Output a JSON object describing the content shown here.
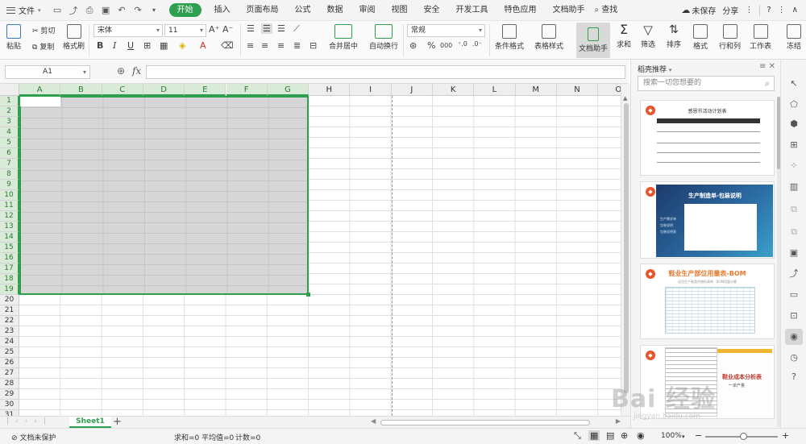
{
  "menubar": {
    "file": "文件",
    "tabs": [
      {
        "label": "开始",
        "active": true
      },
      {
        "label": "插入"
      },
      {
        "label": "页面布局"
      },
      {
        "label": "公式"
      },
      {
        "label": "数据"
      },
      {
        "label": "审阅"
      },
      {
        "label": "视图"
      },
      {
        "label": "安全"
      },
      {
        "label": "开发工具"
      },
      {
        "label": "特色应用"
      },
      {
        "label": "文档助手"
      }
    ],
    "search": "查找",
    "unsaved": "未保存",
    "share": "分享",
    "accent": "#2e9e4f"
  },
  "ribbon": {
    "paste": "粘贴",
    "cut": "剪切",
    "copy": "复制",
    "format_painter": "格式刷",
    "font_name": "宋体",
    "font_size": "11",
    "bold": "B",
    "italic": "I",
    "underline": "U",
    "font_grow": "A⁺",
    "font_shrink": "A⁻",
    "merge_center": "合并居中",
    "wrap_text": "自动换行",
    "number_format": "常规",
    "percent": "%",
    "thousands": "000",
    "cond_format": "条件格式",
    "table_style": "表格样式",
    "doc_helper": "文档助手",
    "sum": "求和",
    "filter": "筛选",
    "sort": "排序",
    "format": "格式",
    "rows_cols": "行和列",
    "worksheet": "工作表",
    "freeze": "冻结"
  },
  "formula_bar": {
    "name_box": "A1",
    "fx": "fx",
    "value": ""
  },
  "grid": {
    "columns": [
      "A",
      "B",
      "C",
      "D",
      "E",
      "F",
      "G",
      "H",
      "I",
      "J",
      "K",
      "L",
      "M",
      "N",
      "O"
    ],
    "rows": [
      "1",
      "2",
      "3",
      "4",
      "5",
      "6",
      "7",
      "8",
      "9",
      "10",
      "11",
      "12",
      "13",
      "14",
      "15",
      "16",
      "17",
      "18",
      "19",
      "20",
      "21",
      "22",
      "23",
      "24",
      "25",
      "26",
      "27",
      "28",
      "29",
      "30",
      "31"
    ],
    "selection": "A1:G19"
  },
  "sheets": {
    "tabs": [
      "Sheet1"
    ],
    "add": "+"
  },
  "status": {
    "protect": "文档未保护",
    "sum": "求和=0",
    "avg": "平均值=0",
    "count": "计数=0",
    "zoom": "100%",
    "minus": "−",
    "plus": "+"
  },
  "pane": {
    "title": "稻壳推荐",
    "search_placeholder": "搜索一切您想要的",
    "cards": [
      {
        "title": "感恩节活动计划表"
      },
      {
        "title": "生产制造单-包装说明",
        "items": [
          "生产需求单",
          "包装说明",
          "包装说明表"
        ]
      },
      {
        "title": "鞋业生产部位用量表-BOM",
        "subtitle": "适用生产鞋类的物料清单 · BOM用量计算"
      },
      {
        "title": "鞋业成本分析表",
        "subtitle": "一单产量"
      }
    ]
  },
  "watermark": {
    "text": "Bai 经验",
    "url": "jingyan.baidu.com"
  }
}
